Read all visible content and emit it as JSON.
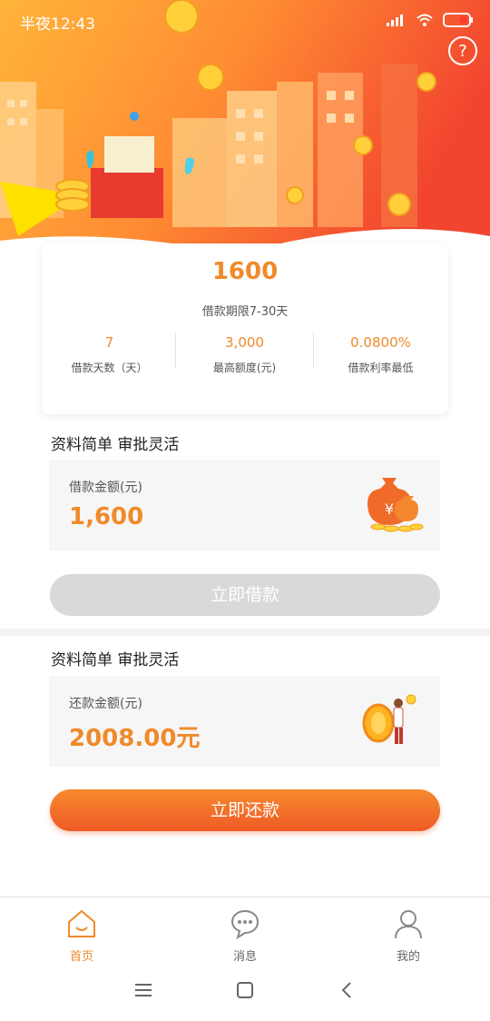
{
  "status_bar": {
    "time": "半夜12:43"
  },
  "summary": {
    "headline_amount": "1600",
    "period": "借款期限7-30天",
    "stats": [
      {
        "value": "7",
        "label": "借款天数（天）"
      },
      {
        "value": "3,000",
        "label": "最高额度(元)"
      },
      {
        "value": "0.0800%",
        "label": "借款利率最低"
      }
    ]
  },
  "loan": {
    "title": "资料简单 审批灵活",
    "amount_label": "借款金额(元)",
    "amount": "1,600",
    "button": "立即借款"
  },
  "repay": {
    "title": "资料简单 审批灵活",
    "amount_label": "还款金额(元)",
    "amount": "2008.00元",
    "button": "立即还款"
  },
  "nav": {
    "items": [
      {
        "label": "首页",
        "active": true,
        "icon": "home-icon"
      },
      {
        "label": "消息",
        "active": false,
        "icon": "message-icon"
      },
      {
        "label": "我的",
        "active": false,
        "icon": "user-icon"
      }
    ]
  },
  "colors": {
    "accent": "#f08a2a",
    "active_nav": "#f08a2a",
    "inactive_nav": "#777777"
  }
}
